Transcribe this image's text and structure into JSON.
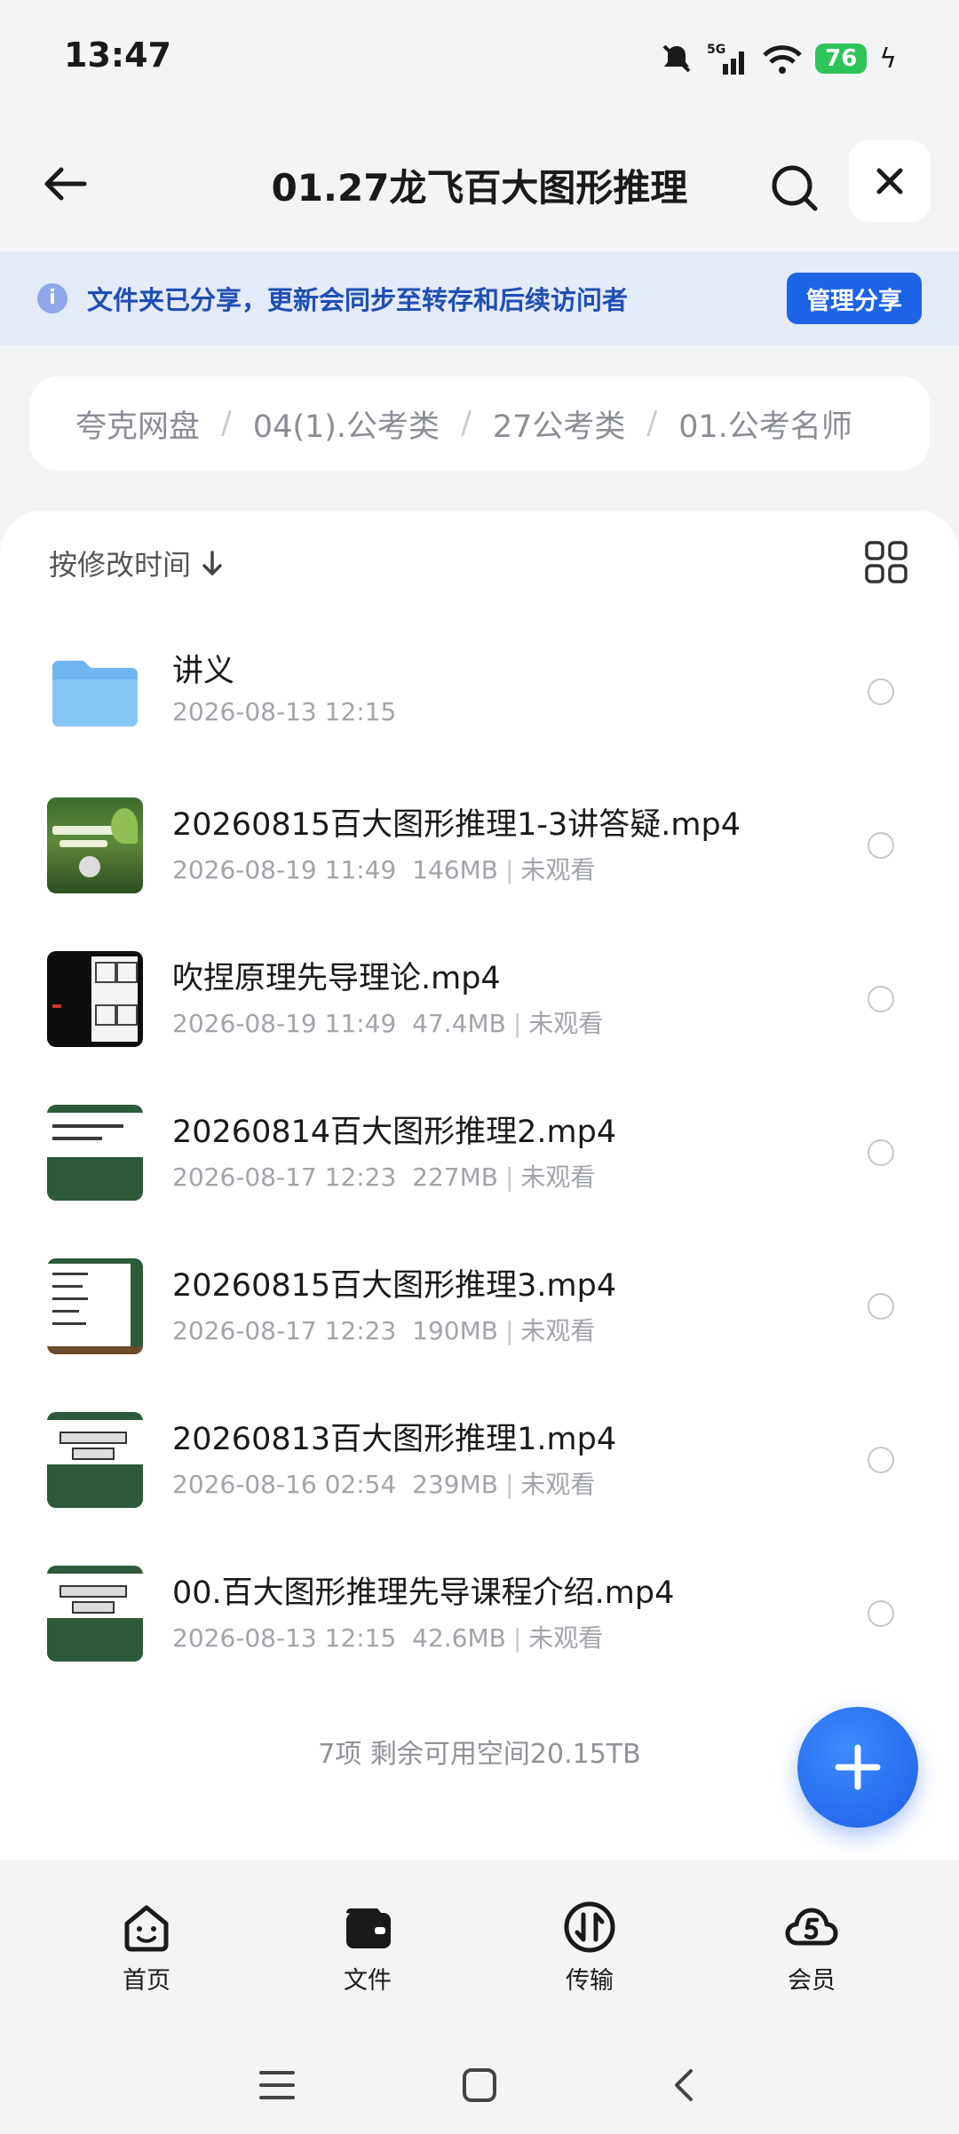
{
  "status_bar": {
    "time": "13:47",
    "network": "5G",
    "battery": "76"
  },
  "header": {
    "title": "01.27龙飞百大图形推理"
  },
  "share_banner": {
    "text": "文件夹已分享，更新会同步至转存和后续访问者",
    "button": "管理分享"
  },
  "breadcrumb": [
    "夸克网盘",
    "04(1).公考类",
    "27公考类",
    "01.公考名师"
  ],
  "sort": {
    "label": "按修改时间"
  },
  "files": [
    {
      "name": "讲义",
      "date": "2026-08-13 12:15",
      "size": "",
      "status": "",
      "thumb": "folder-icon"
    },
    {
      "name": "20260815百大图形推理1-3讲答疑.mp4",
      "date": "2026-08-19 11:49",
      "size": "146MB",
      "status": "未观看",
      "thumb": "video-thumbnail"
    },
    {
      "name": "吹捏原理先导理论.mp4",
      "date": "2026-08-19 11:49",
      "size": "47.4MB",
      "status": "未观看",
      "thumb": "video-thumbnail"
    },
    {
      "name": "20260814百大图形推理2.mp4",
      "date": "2026-08-17 12:23",
      "size": "227MB",
      "status": "未观看",
      "thumb": "video-thumbnail"
    },
    {
      "name": "20260815百大图形推理3.mp4",
      "date": "2026-08-17 12:23",
      "size": "190MB",
      "status": "未观看",
      "thumb": "video-thumbnail"
    },
    {
      "name": "20260813百大图形推理1.mp4",
      "date": "2026-08-16 02:54",
      "size": "239MB",
      "status": "未观看",
      "thumb": "video-thumbnail"
    },
    {
      "name": "00.百大图形推理先导课程介绍.mp4",
      "date": "2026-08-13 12:15",
      "size": "42.6MB",
      "status": "未观看",
      "thumb": "video-thumbnail"
    }
  ],
  "summary": "7项 剩余可用空间20.15TB",
  "bottom_nav": [
    {
      "label": "首页",
      "icon": "home-smile-icon"
    },
    {
      "label": "文件",
      "icon": "wallet-folder-icon"
    },
    {
      "label": "传输",
      "icon": "transfer-icon"
    },
    {
      "label": "会员",
      "icon": "vip-cloud-icon"
    }
  ],
  "colors": {
    "accent": "#1d63e6",
    "banner_bg": "#e3eaf8",
    "banner_text": "#1f4fb3",
    "battery": "#2ec45a"
  }
}
